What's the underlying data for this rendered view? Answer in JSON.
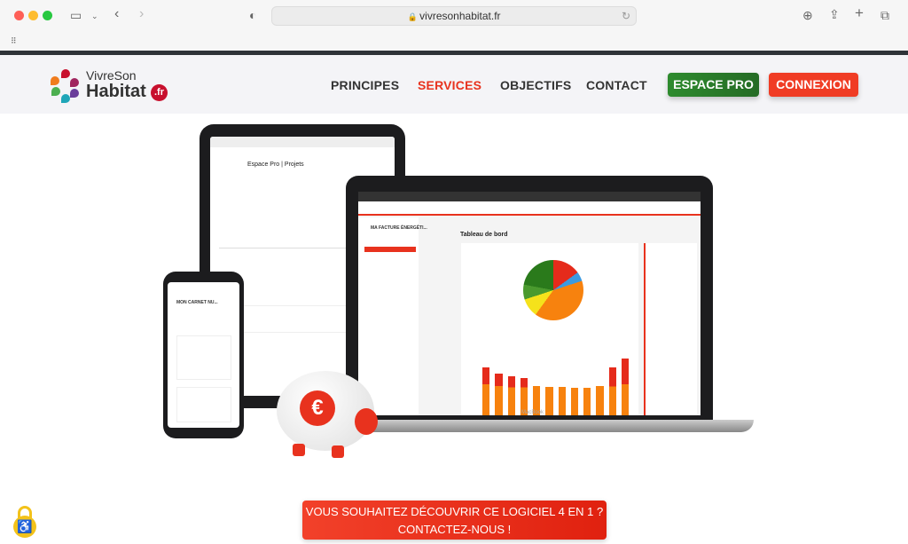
{
  "browser": {
    "url": "vivresonhabitat.fr",
    "traffic_colors": [
      "#fe5f57",
      "#febc2e",
      "#28c840"
    ]
  },
  "header": {
    "logo": {
      "line1": "VivreSon",
      "line2": "Habitat",
      "tld": ".fr"
    },
    "nav": [
      {
        "label": "PRINCIPES",
        "active": false
      },
      {
        "label": "SERVICES",
        "active": true
      },
      {
        "label": "OBJECTIFS",
        "active": false
      },
      {
        "label": "CONTACT",
        "active": false
      }
    ],
    "espace_pro": "ESPACE PRO",
    "connexion": "CONNEXION",
    "colors": {
      "active": "#e8321e",
      "espace_pro": "#2e7d32",
      "connexion": "#f03c24"
    }
  },
  "hero": {
    "tablet_title": "Espace Pro | Projets",
    "laptop_section": "MA FACTURE ÉNERGÉTI...",
    "laptop_title": "Tableau de bord",
    "laptop_brand": "MacBook",
    "phone_title": "MON CARNET NU..."
  },
  "cta": {
    "line1": "VOUS SOUHAITEZ DÉCOUVRIR CE LOGICIEL 4 EN 1 ?",
    "line2": "CONTACTEZ-NOUS !"
  },
  "accessibility_icon": "accessibility-lock-icon"
}
